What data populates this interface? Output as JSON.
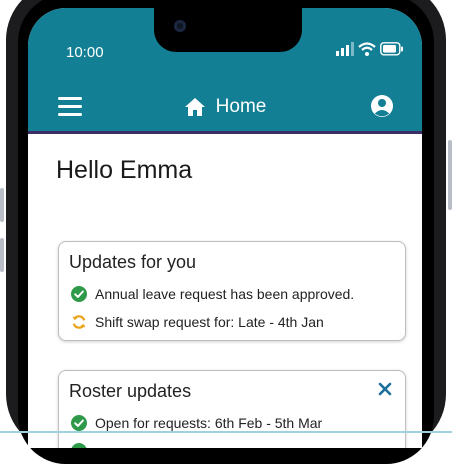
{
  "status_bar": {
    "time": "10:00"
  },
  "header": {
    "title": "Home"
  },
  "greeting": "Hello Emma",
  "cards": {
    "updates": {
      "title": "Updates for you",
      "items": [
        {
          "icon": "check-circle-icon",
          "text": "Annual leave request has been approved."
        },
        {
          "icon": "sync-icon",
          "text": "Shift swap request for: Late - 4th Jan"
        }
      ]
    },
    "roster": {
      "title": "Roster updates",
      "items": [
        {
          "icon": "check-circle-icon",
          "text": "Open for requests: 6th Feb - 5th Mar"
        }
      ]
    }
  },
  "colors": {
    "header": "#127f95",
    "header_border": "#3d2d66",
    "success": "#2e9a49",
    "pending": "#e8a317",
    "close": "#1f6f9b"
  }
}
